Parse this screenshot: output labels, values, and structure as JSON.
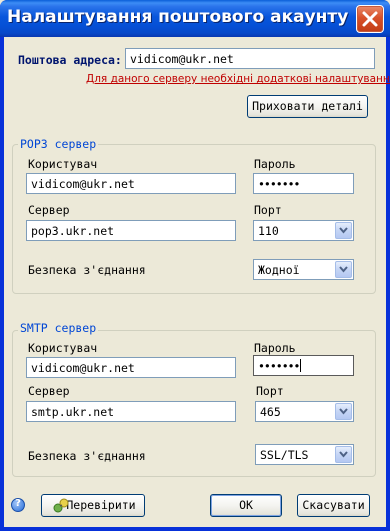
{
  "window": {
    "title": "Налаштування поштового акаунту"
  },
  "email": {
    "label": "Поштова адреса:",
    "value": "vidicom@ukr.net",
    "notice": "Для даного серверу необхідні додаткові налаштування"
  },
  "hide_details_button": "Приховати деталі",
  "pop3": {
    "title": "POP3 сервер",
    "user_label": "Користувач",
    "user_value": "vidicom@ukr.net",
    "password_label": "Пароль",
    "password_value": "•••••••",
    "server_label": "Сервер",
    "server_value": "pop3.ukr.net",
    "port_label": "Порт",
    "port_value": "110",
    "security_label": "Безпека з'єднання",
    "security_value": "Жодної"
  },
  "smtp": {
    "title": "SMTP сервер",
    "user_label": "Користувач",
    "user_value": "vidicom@ukr.net",
    "password_label": "Пароль",
    "password_value": "•••••••",
    "server_label": "Сервер",
    "server_value": "smtp.ukr.net",
    "port_label": "Порт",
    "port_value": "465",
    "security_label": "Безпека з'єднання",
    "security_value": "SSL/TLS"
  },
  "footer": {
    "help_glyph": "?",
    "check_button": "Перевірити",
    "ok_button": "OK",
    "cancel_button": "Скасувати"
  },
  "icons": {
    "close": "close-icon",
    "help": "help-icon",
    "check": "connection-check-icon",
    "dropdown": "chevron-down-icon"
  },
  "colors": {
    "titlebar": "#0856dc",
    "close_button": "#d8512a",
    "notice": "#c00000",
    "group_title": "#0046d5",
    "label_bold": "#00156e",
    "dialog_bg": "#ece9d8"
  }
}
